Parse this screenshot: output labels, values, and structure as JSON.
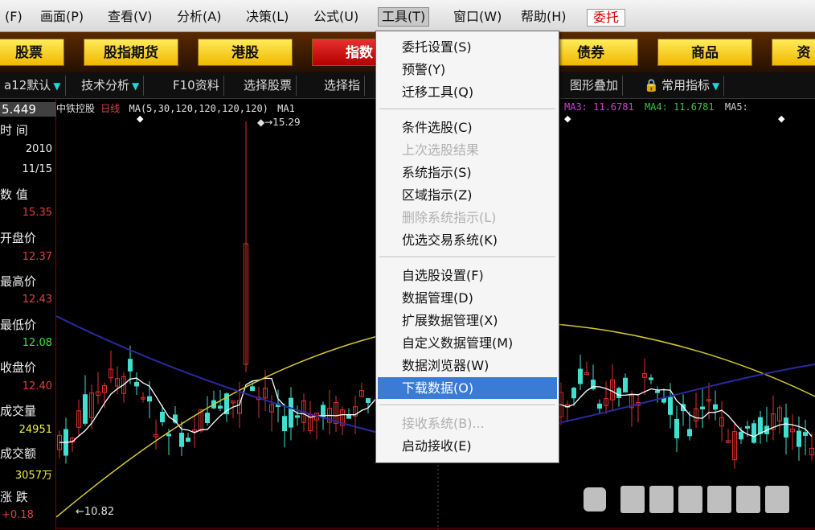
{
  "menubar": {
    "items": [
      {
        "label": "(F)"
      },
      {
        "label": "画面(P)"
      },
      {
        "label": "查看(V)"
      },
      {
        "label": "分析(A)"
      },
      {
        "label": "决策(L)"
      },
      {
        "label": "公式(U)"
      },
      {
        "label": "工具(T)"
      },
      {
        "label": "窗口(W)"
      },
      {
        "label": "帮助(H)"
      }
    ],
    "trade_label": "委托"
  },
  "market_tabs": [
    "股票",
    "股指期货",
    "港股",
    "指数",
    "债券",
    "商品",
    "资"
  ],
  "toolbar": {
    "ma_label": "a12默认",
    "tech_label": "技术分析",
    "f10_label": "F10资料",
    "select_label": "选择股票",
    "select2_label": "选择指",
    "overlay_label": "图形叠加",
    "common_label": "常用指标"
  },
  "info": {
    "price_head": "5.449",
    "time_label": "时  间",
    "year": "2010",
    "date": "11/15",
    "value_label": "数  值",
    "value": "15.35",
    "open_label": "开盘价",
    "open": "12.37",
    "high_label": "最高价",
    "high": "12.43",
    "low_label": "最低价",
    "low": "12.08",
    "close_label": "收盘价",
    "close": "12.40",
    "volume_label": "成交量",
    "volume": "24951",
    "amount_label": "成交额",
    "amount": "3057万",
    "change_label": "涨  跌",
    "change": "+0.18",
    "low_marker": "←10.82"
  },
  "chart_header": {
    "name": "中铁控股",
    "period": "日线",
    "ma_params": "MA(5,30,120,120,120,120)",
    "ma1": "MA1",
    "ma3": "MA3: 11.6781",
    "ma4": "MA4: 11.6781",
    "ma5": "MA5:",
    "peak_label": "15.29"
  },
  "dropdown": {
    "items": [
      {
        "label": "委托设置(S)",
        "enabled": true
      },
      {
        "label": "预警(Y)",
        "enabled": true
      },
      {
        "label": "迁移工具(Q)",
        "enabled": true
      },
      {
        "label": "条件选股(C)",
        "enabled": true
      },
      {
        "label": "上次选股结果",
        "enabled": false
      },
      {
        "label": "系统指示(S)",
        "enabled": true
      },
      {
        "label": "区域指示(Z)",
        "enabled": true
      },
      {
        "label": "删除系统指示(L)",
        "enabled": false
      },
      {
        "label": "优选交易系统(K)",
        "enabled": true
      },
      {
        "label": "自选股设置(F)",
        "enabled": true
      },
      {
        "label": "数据管理(D)",
        "enabled": true
      },
      {
        "label": "扩展数据管理(X)",
        "enabled": true
      },
      {
        "label": "自定义数据管理(M)",
        "enabled": true
      },
      {
        "label": "数据浏览器(W)",
        "enabled": true
      },
      {
        "label": "下载数据(O)",
        "enabled": true,
        "highlighted": true
      },
      {
        "label": "接收系统(B)...",
        "enabled": false
      },
      {
        "label": "启动接收(E)",
        "enabled": true
      }
    ]
  },
  "colors": {
    "up": "#e03030",
    "down": "#40e0d0",
    "ma_white": "#ffffff",
    "ma_yellow": "#d4c830",
    "ma_blue": "#2a2aa0",
    "highlight": "#3a7bd5"
  }
}
